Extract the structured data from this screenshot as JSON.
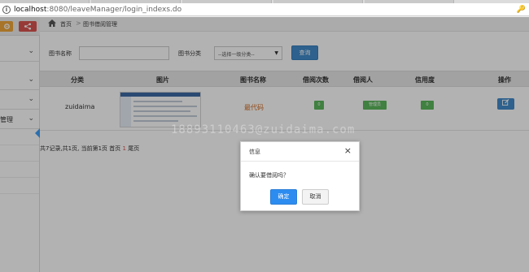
{
  "browser": {
    "url_host": "localhost",
    "url_rest": ":8080/leaveManager/login_indexs.do",
    "info_icon": "i",
    "key_icon": "🔑"
  },
  "sidebar": {
    "tool_icons": [
      "settings-icon",
      "share-icon"
    ],
    "chevron": "⌄",
    "items": [
      {
        "label": ""
      },
      {
        "label": ""
      },
      {
        "label": ""
      },
      {
        "label": "管理"
      }
    ]
  },
  "breadcrumb": {
    "home": "首页",
    "separator": ">",
    "current": "图书借阅管理"
  },
  "search": {
    "book_name_label": "图书名称",
    "book_name_value": "",
    "category_label": "图书分类",
    "category_value": "--选择一级分类--",
    "query_button": "查询"
  },
  "table": {
    "headers": [
      "分类",
      "图片",
      "图书名称",
      "借阅次数",
      "借阅人",
      "信用度",
      "操作"
    ],
    "rows": [
      {
        "category": "zuidaima",
        "name": "最代码",
        "borrow_count_badge": "0",
        "borrower_badge": "管理员",
        "credit_badge": "0"
      }
    ]
  },
  "pager": {
    "prefix": "共7记录,共1页, 当前第1页 首页 ",
    "current_page": "1",
    "suffix": " 尾页"
  },
  "watermark": "18893110463@zuidaima.com",
  "dialog": {
    "title": "信息",
    "close": "×",
    "message": "确认要借阅吗？",
    "ok": "确定",
    "cancel": "取消"
  },
  "colors": {
    "primary": "#428bca",
    "success": "#5cb85c",
    "danger": "#d9534f",
    "warning": "#f0a63a",
    "dialog_ok": "#2d8cf0"
  }
}
